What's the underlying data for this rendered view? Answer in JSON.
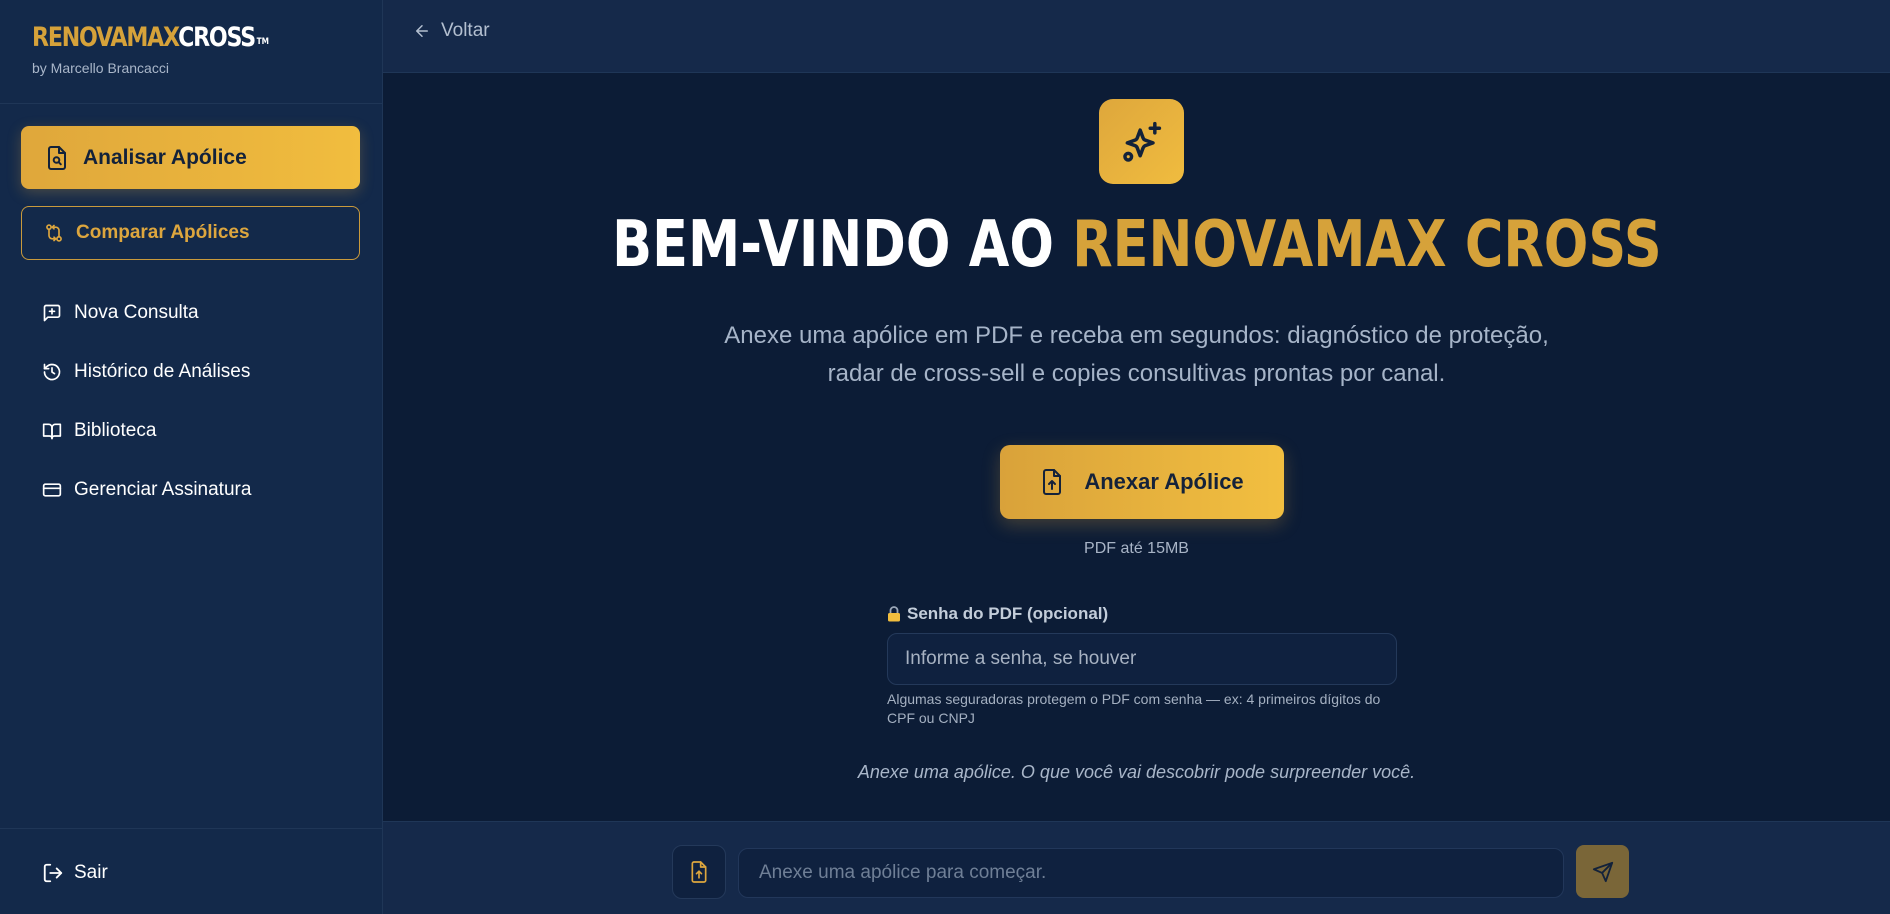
{
  "brand": {
    "logo_part1": "RENOVAMAX",
    "logo_part2": "CROSS",
    "logo_tm": "TM",
    "subtitle": "by Marcello Brancacci"
  },
  "sidebar": {
    "primary": {
      "label": "Analisar Apólice",
      "icon": "document-search-icon"
    },
    "secondary": {
      "label": "Comparar Apólices",
      "icon": "compare-arrows-icon"
    },
    "items": [
      {
        "label": "Nova Consulta",
        "icon": "message-plus-icon"
      },
      {
        "label": "Histórico de Análises",
        "icon": "history-icon"
      },
      {
        "label": "Biblioteca",
        "icon": "book-open-icon"
      },
      {
        "label": "Gerenciar Assinatura",
        "icon": "credit-card-icon"
      }
    ],
    "logout": {
      "label": "Sair",
      "icon": "logout-icon"
    }
  },
  "topbar": {
    "back_label": "Voltar"
  },
  "hero": {
    "title_white": "BEM-VINDO AO ",
    "title_gold": "RENOVAMAX CROSS",
    "desc_line1": "Anexe uma apólice em PDF e receba em segundos: diagnóstico de proteção,",
    "desc_line2": "radar de cross-sell e copies consultivas prontas por canal."
  },
  "upload": {
    "button_label": "Anexar Apólice",
    "hint": "PDF até 15MB"
  },
  "password": {
    "label": "Senha do PDF (opcional)",
    "placeholder": "Informe a senha, se houver",
    "help": "Algumas seguradoras protegem o PDF com senha — ex: 4 primeiros dígitos do CPF ou CNPJ"
  },
  "tagline": "Anexe uma apólice. O que você vai descobrir pode surpreender você.",
  "composer": {
    "placeholder": "Anexe uma apólice para começar."
  },
  "colors": {
    "accent_gold": "#d6a23a",
    "background": "#0c1c36",
    "sidebar": "#13294a"
  }
}
